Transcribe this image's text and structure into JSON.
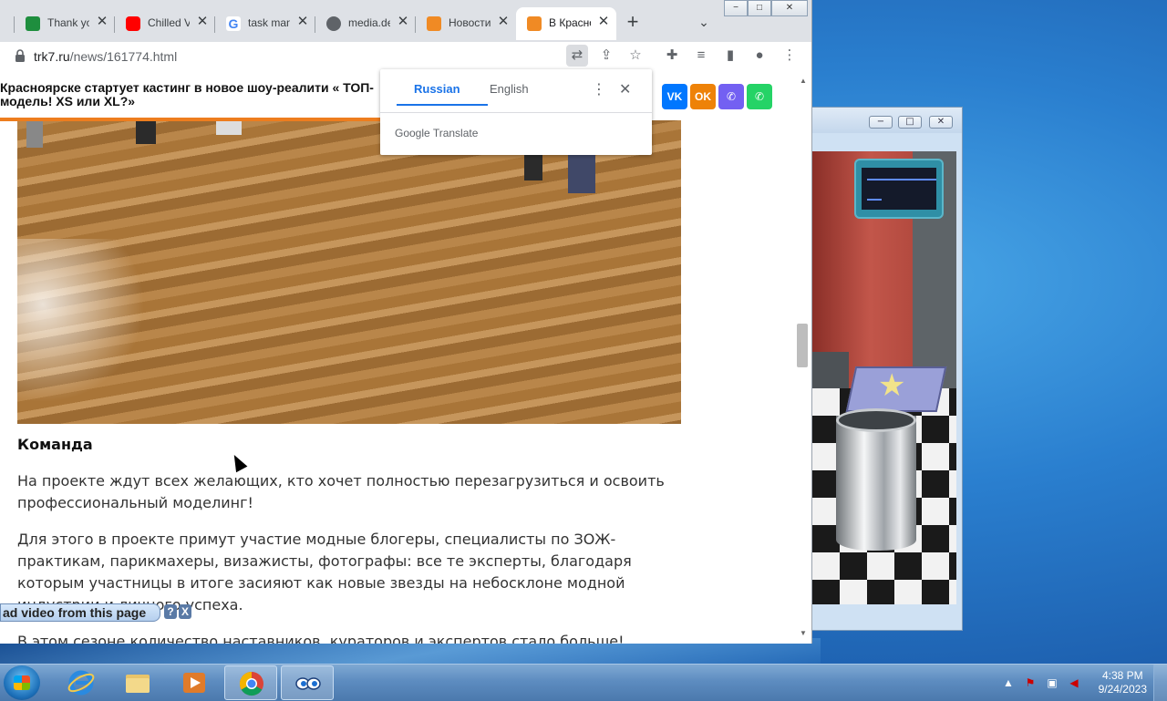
{
  "browser": {
    "tabs": [
      {
        "title": "Thank you",
        "favicon": "green-check-icon",
        "color": "#1e8e3e"
      },
      {
        "title": "Chilled Vibes",
        "favicon": "youtube-icon",
        "color": "#ff0000"
      },
      {
        "title": "task manager",
        "favicon": "google-icon",
        "color": "#4285f4"
      },
      {
        "title": "media.de",
        "favicon": "globe-icon",
        "color": "#5f6368"
      },
      {
        "title": "Новости",
        "favicon": "trk7-icon",
        "color": "#f08a24"
      },
      {
        "title": "В Красноярске",
        "favicon": "trk7-icon",
        "color": "#f08a24"
      }
    ],
    "url_host": "trk7.ru",
    "url_path": "/news/161774.html",
    "window_controls": {
      "minimize": "−",
      "maximize": "□",
      "close": "✕"
    }
  },
  "page": {
    "sticky_title": "Красноярске стартует кастинг в новое шоу-реалити « ТОП-модель! XS или XL?»",
    "social": [
      {
        "label": "VK",
        "color": "#0077ff",
        "icon": "vk-icon"
      },
      {
        "label": "OK",
        "color": "#ee8208",
        "icon": "odnoklassniki-icon"
      },
      {
        "label": "✆",
        "color": "#7360f2",
        "icon": "viber-icon"
      },
      {
        "label": "✆",
        "color": "#25d366",
        "icon": "whatsapp-icon"
      }
    ],
    "heading": "Команда",
    "paragraphs": [
      "На проекте ждут всех желающих, кто хочет полностью перезагрузиться и освоить профессиональный моделинг!",
      "Для этого в проекте примут участие модные блогеры, специалисты по ЗОЖ-практикам, парикмахеры, визажисты, фотографы: все те эксперты, благодаря которым участницы в итоге засияют как новые звезды на небосклоне модной индустрии и личного успеха.",
      "В этом сезоне количество наставников, кураторов и экспертов стало больше!"
    ]
  },
  "translate": {
    "lang_from": "Russian",
    "lang_to": "English",
    "brand": "Google Translate"
  },
  "download_helper": {
    "label": "ad video from this page",
    "help": "?",
    "close": "X"
  },
  "taskbar": {
    "apps": [
      {
        "name": "internet-explorer",
        "icon": "ie-icon"
      },
      {
        "name": "file-explorer",
        "icon": "folder-icon"
      },
      {
        "name": "media-player",
        "icon": "media-player-icon"
      },
      {
        "name": "chrome",
        "icon": "chrome-icon"
      },
      {
        "name": "game",
        "icon": "eyes-icon"
      }
    ],
    "time": "4:38 PM",
    "date": "9/24/2023"
  }
}
